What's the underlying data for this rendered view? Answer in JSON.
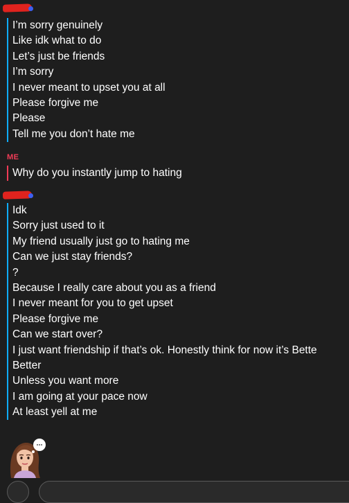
{
  "conversation": {
    "group1": {
      "messages": [
        "I’m sorry genuinely",
        "Like idk what to do",
        "Let’s just be friends",
        "I’m sorry",
        "I never meant to upset you at all",
        "Please forgive me",
        "Please",
        "Tell me you don’t hate me"
      ]
    },
    "group2": {
      "sender": "ME",
      "messages": [
        "Why do you instantly jump to hating"
      ]
    },
    "group3": {
      "messages": [
        "Idk",
        "Sorry just used to it",
        "My friend usually just go to hating me",
        "Can we just stay friends?",
        "?",
        "Because I really care about you as a friend",
        "I never meant for you to get upset",
        "Please forgive me",
        "Can we start over?",
        "I just want friendship if that’s ok. Honestly think for now it’s Bette",
        "Better",
        "Unless you want more",
        "I am going at your pace now",
        "At least yell at me"
      ]
    }
  },
  "colors": {
    "background": "#1e1e1e",
    "their_accent": "#0eadff",
    "my_accent": "#f23c57",
    "redaction": "#e0231e"
  },
  "icons": {
    "avatar": "bitmoji-avatar-icon"
  }
}
